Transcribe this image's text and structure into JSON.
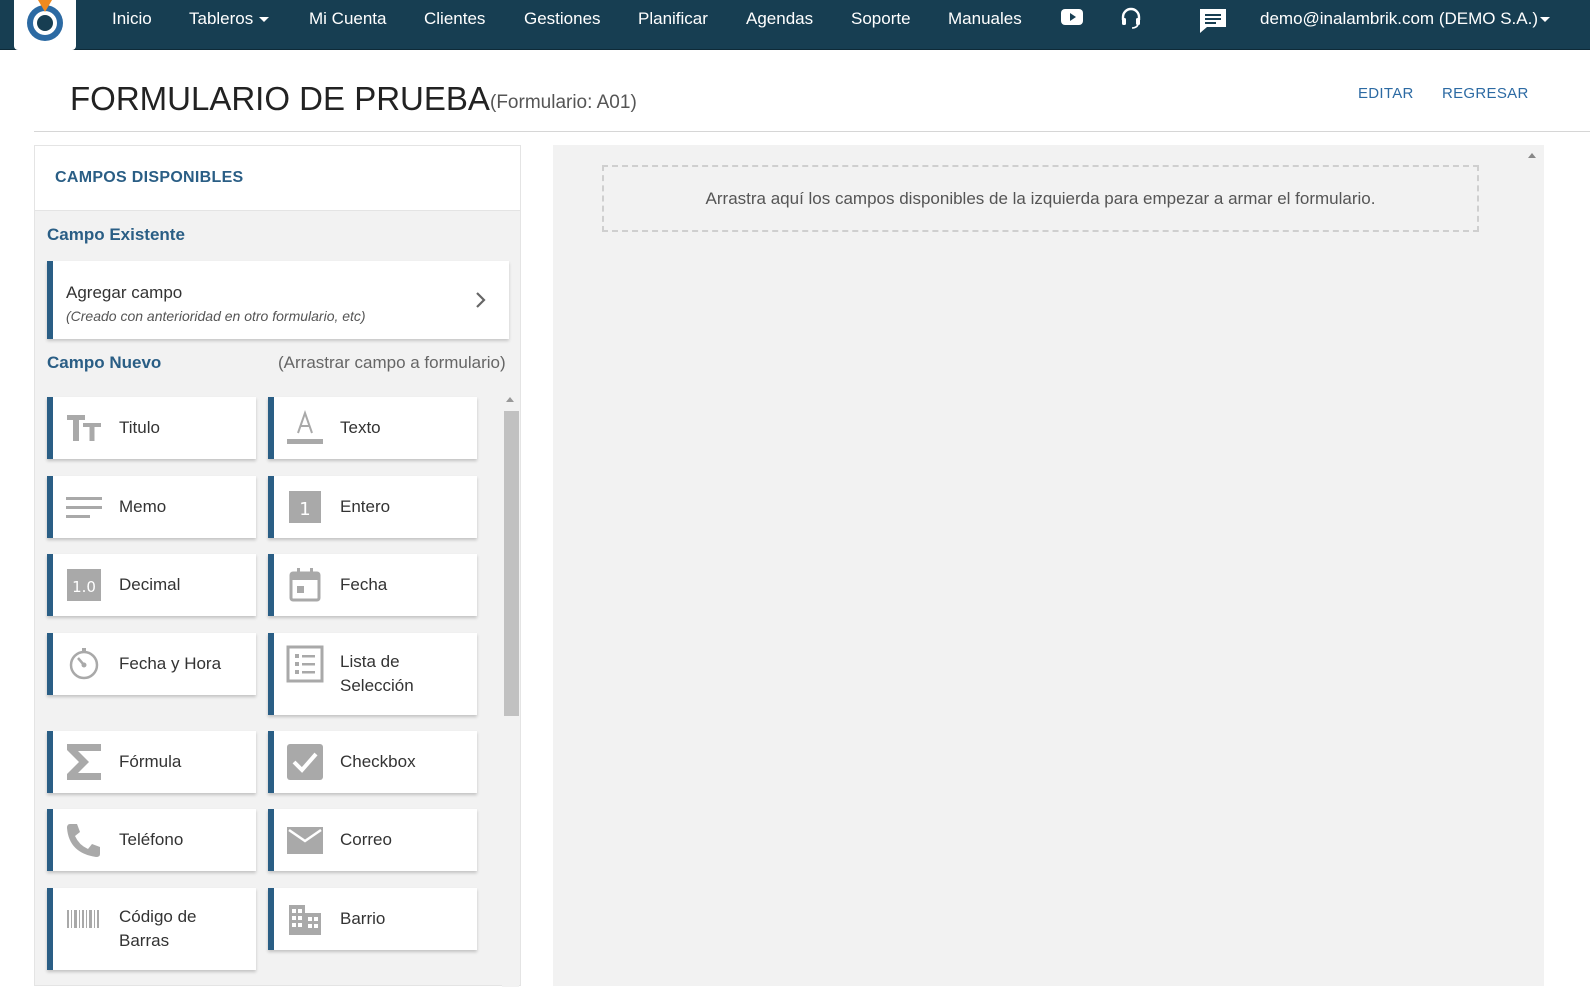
{
  "nav": {
    "items": [
      "Inicio",
      "Tableros",
      "Mi Cuenta",
      "Clientes",
      "Gestiones",
      "Planificar",
      "Agendas",
      "Soporte",
      "Manuales"
    ],
    "icons": [
      "youtube-icon",
      "headset-icon",
      "chat-icon"
    ],
    "user": "demo@inalambrik.com (DEMO S.A.)"
  },
  "header": {
    "title": "FORMULARIO DE PRUEBA",
    "subtitle": "(Formulario: A01)",
    "edit": "EDITAR",
    "back": "REGRESAR"
  },
  "panel": {
    "title": "CAMPOS DISPONIBLES",
    "existing_section": "Campo Existente",
    "existing_label": "Agregar campo",
    "existing_sub": "(Creado con anterioridad en otro formulario, etc)",
    "new_section": "Campo Nuevo",
    "new_hint": "(Arrastrar campo a formulario)",
    "fields": [
      {
        "label": "Titulo",
        "icon": "title-icon"
      },
      {
        "label": "Texto",
        "icon": "text-icon"
      },
      {
        "label": "Memo",
        "icon": "memo-icon"
      },
      {
        "label": "Entero",
        "icon": "integer-icon"
      },
      {
        "label": "Decimal",
        "icon": "decimal-icon"
      },
      {
        "label": "Fecha",
        "icon": "calendar-icon"
      },
      {
        "label": "Fecha y Hora",
        "icon": "clock-icon"
      },
      {
        "label": "Lista de Selección",
        "icon": "list-icon"
      },
      {
        "label": "Fórmula",
        "icon": "sigma-icon"
      },
      {
        "label": "Checkbox",
        "icon": "checkbox-icon"
      },
      {
        "label": "Teléfono",
        "icon": "phone-icon"
      },
      {
        "label": "Correo",
        "icon": "mail-icon"
      },
      {
        "label": "Código de Barras",
        "icon": "barcode-icon"
      },
      {
        "label": "Barrio",
        "icon": "building-icon"
      }
    ]
  },
  "canvas": {
    "dropzone_text": "Arrastra aquí los campos disponibles de la izquierda para empezar a armar el formulario."
  },
  "colors": {
    "navbar": "#173e52",
    "accent": "#2a5e85",
    "link": "#2c6aa3",
    "icon_gray": "#a9a9a9"
  }
}
